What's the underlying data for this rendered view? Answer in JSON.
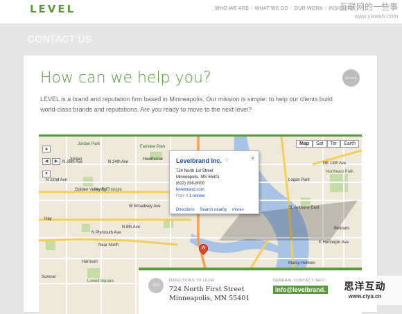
{
  "header": {
    "logo": "LEVEL",
    "nav": [
      "WHO WE ARE",
      "WHAT WE DO",
      "OUR WORK",
      "INSIGHTS"
    ],
    "watermark_line1": "互联网的一些事",
    "watermark_line2": "www.yixieshi.com"
  },
  "section_title": "CONTACT US",
  "card": {
    "headline": "How can we help you?",
    "share_label": "SHARE",
    "intro": "LEVEL is a brand and reputation firm based in Minneapolis. Our mission is simple: to help our clients build world-class brands and reputations. Are you ready to move to the next level?"
  },
  "map": {
    "map_types": [
      "Map",
      "Sat",
      "Ter",
      "Earth"
    ],
    "active_type": "Map",
    "labels": {
      "jordan_park": "Jordan Park",
      "jordan": "Jordan",
      "fairview_park": "Fairview Park",
      "hawthorne": "Hawthorne",
      "n_26th": "N 26th Ave",
      "n_24th": "N 24th Ave",
      "n_22nd": "N 22nd Ave",
      "irving_triangle": "Irving Triangle",
      "golden_valley": "Golden Valley Rd",
      "w_broadway": "W Broadway Ave",
      "near_north": "Near North",
      "harrison": "Harrison",
      "lowell_square": "Lowell Square",
      "n_plymouth": "N Plymouth Ave",
      "n_8th": "N 8th Ave",
      "logan_park": "Logan Park",
      "northeast_park": "Northeast Park",
      "beltrami": "Beltrami",
      "marcy_holmes": "Marcy-Holmes",
      "st_anthony_west": "St. Anthony East",
      "ne_18th": "NE 18th Ave",
      "e_hennepin": "E Hennepin Ave",
      "hay": "Hay",
      "sumner": "Sumner"
    },
    "infobox": {
      "title": "Levelbrand Inc.",
      "close": "×",
      "star": "☆",
      "street": "724 North 1st Street",
      "city": "Minneapolis, MN 55401",
      "phone": "(612) 338-8000",
      "website": "levelbrand.com",
      "rate_label": "Rate it",
      "review": "1 review",
      "actions": [
        "Directions",
        "Search nearby",
        "more»"
      ]
    },
    "pin_letter": "A"
  },
  "contact": {
    "go_label": "GO",
    "directions_label": "DIRECTIONS TO LEVEL",
    "address_line1": "724 North First Street",
    "address_line2": "Minneapolis, MN 55401",
    "general_label": "GENERAL CONTACT INFO",
    "email": "info@levelbrand."
  },
  "watermark_bottom": {
    "line1": "思洋互动",
    "line2": "www.ciya.cn"
  }
}
